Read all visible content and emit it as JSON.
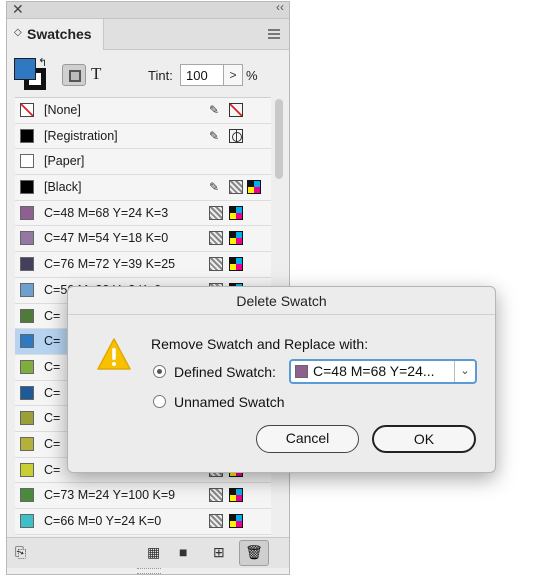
{
  "panel": {
    "tab_label": "Swatches",
    "tint_label": "Tint:",
    "tint_value": "100",
    "tint_unit": "%",
    "fill_color": "#2e79c2",
    "swatches": [
      {
        "name": "[None]",
        "color": "none",
        "icons": [
          "lock-icon",
          "none-indicator-icon"
        ]
      },
      {
        "name": "[Registration]",
        "color": "#000000",
        "icons": [
          "lock-icon",
          "registration-icon"
        ]
      },
      {
        "name": "[Paper]",
        "color": "#ffffff",
        "icons": []
      },
      {
        "name": "[Black]",
        "color": "#000000",
        "icons": [
          "lock-icon",
          "process-icon",
          "cmyk-icon"
        ]
      },
      {
        "name": "C=48 M=68 Y=24 K=3",
        "color": "#8e6090",
        "icons": [
          "process-icon",
          "cmyk-icon"
        ]
      },
      {
        "name": "C=47 M=54 Y=18 K=0",
        "color": "#9478a3",
        "icons": [
          "process-icon",
          "cmyk-icon"
        ]
      },
      {
        "name": "C=76 M=72 Y=39 K=25",
        "color": "#433f5d",
        "icons": [
          "process-icon",
          "cmyk-icon"
        ]
      },
      {
        "name": "C=56 M=28 Y=2 K=0",
        "color": "#6e9fd1",
        "icons": [
          "process-icon",
          "cmyk-icon"
        ]
      },
      {
        "name": "C=",
        "color": "#4f7a37",
        "icons": [
          "process-icon",
          "cmyk-icon"
        ]
      },
      {
        "name": "C=",
        "color": "#2e79c2",
        "icons": [
          "process-icon",
          "cmyk-icon"
        ],
        "selected": true
      },
      {
        "name": "C=",
        "color": "#7fae3e",
        "icons": [
          "process-icon",
          "cmyk-icon"
        ]
      },
      {
        "name": "C=",
        "color": "#1f5a96",
        "icons": [
          "process-icon",
          "cmyk-icon"
        ]
      },
      {
        "name": "C=",
        "color": "#9aa037",
        "icons": [
          "process-icon",
          "cmyk-icon"
        ]
      },
      {
        "name": "C=",
        "color": "#b4b13a",
        "icons": [
          "process-icon",
          "cmyk-icon"
        ]
      },
      {
        "name": "C=",
        "color": "#c9cf33",
        "icons": [
          "process-icon",
          "cmyk-icon"
        ]
      },
      {
        "name": "C=73 M=24 Y=100 K=9",
        "color": "#4b8a3c",
        "icons": [
          "process-icon",
          "cmyk-icon"
        ]
      },
      {
        "name": "C=66 M=0 Y=24 K=0",
        "color": "#3fbfc8",
        "icons": [
          "process-icon",
          "cmyk-icon"
        ]
      }
    ]
  },
  "dialog": {
    "title": "Delete Swatch",
    "heading": "Remove Swatch and Replace with:",
    "option_defined": "Defined Swatch:",
    "option_unnamed": "Unnamed Swatch",
    "selected_swatch": "C=48 M=68 Y=24...",
    "selected_swatch_color": "#8e6090",
    "cancel_label": "Cancel",
    "ok_label": "OK"
  }
}
